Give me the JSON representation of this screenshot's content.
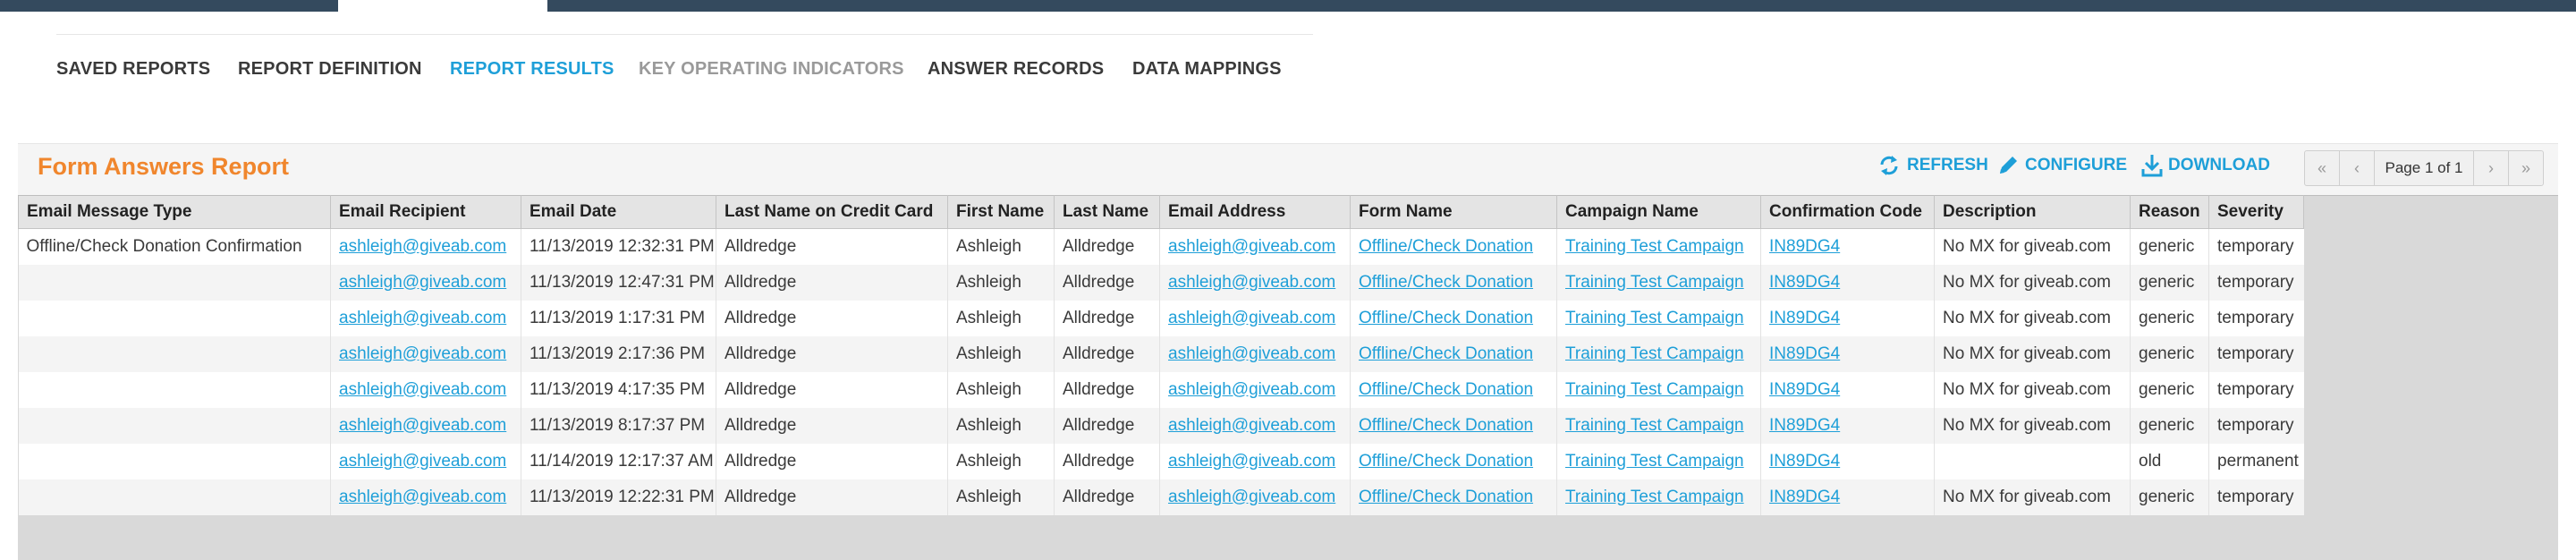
{
  "tabs": [
    {
      "label": "SAVED REPORTS",
      "state": "normal"
    },
    {
      "label": "REPORT DEFINITION",
      "state": "normal"
    },
    {
      "label": "REPORT RESULTS",
      "state": "active"
    },
    {
      "label": "KEY OPERATING INDICATORS",
      "state": "disabled"
    },
    {
      "label": "ANSWER RECORDS",
      "state": "normal"
    },
    {
      "label": "DATA MAPPINGS",
      "state": "normal"
    }
  ],
  "report": {
    "title": "Form Answers Report"
  },
  "actions": {
    "refresh": {
      "label": "REFRESH",
      "icon": "refresh-icon"
    },
    "configure": {
      "label": "CONFIGURE",
      "icon": "pencil-icon"
    },
    "download": {
      "label": "DOWNLOAD",
      "icon": "download-icon"
    }
  },
  "pager": {
    "text": "Page 1 of 1"
  },
  "colors": {
    "accent": "#1e9fd8",
    "title": "#f0862d",
    "topbar": "#344a5e"
  },
  "table": {
    "columns": [
      "Email Message Type",
      "Email Recipient",
      "Email Date",
      "Last Name on Credit Card",
      "First Name",
      "Last Name",
      "Email Address",
      "Form Name",
      "Campaign Name",
      "Confirmation Code",
      "Description",
      "Reason",
      "Severity"
    ],
    "rows": [
      [
        "Offline/Check Donation Confirmation",
        "ashleigh@giveab.com",
        "11/13/2019 12:32:31 PM",
        "Alldredge",
        "Ashleigh",
        "Alldredge",
        "ashleigh@giveab.com",
        "Offline/Check Donation",
        "Training Test Campaign",
        "IN89DG4",
        "No MX for giveab.com",
        "generic",
        "temporary"
      ],
      [
        "",
        "ashleigh@giveab.com",
        "11/13/2019 12:47:31 PM",
        "Alldredge",
        "Ashleigh",
        "Alldredge",
        "ashleigh@giveab.com",
        "Offline/Check Donation",
        "Training Test Campaign",
        "IN89DG4",
        "No MX for giveab.com",
        "generic",
        "temporary"
      ],
      [
        "",
        "ashleigh@giveab.com",
        "11/13/2019 1:17:31 PM",
        "Alldredge",
        "Ashleigh",
        "Alldredge",
        "ashleigh@giveab.com",
        "Offline/Check Donation",
        "Training Test Campaign",
        "IN89DG4",
        "No MX for giveab.com",
        "generic",
        "temporary"
      ],
      [
        "",
        "ashleigh@giveab.com",
        "11/13/2019 2:17:36 PM",
        "Alldredge",
        "Ashleigh",
        "Alldredge",
        "ashleigh@giveab.com",
        "Offline/Check Donation",
        "Training Test Campaign",
        "IN89DG4",
        "No MX for giveab.com",
        "generic",
        "temporary"
      ],
      [
        "",
        "ashleigh@giveab.com",
        "11/13/2019 4:17:35 PM",
        "Alldredge",
        "Ashleigh",
        "Alldredge",
        "ashleigh@giveab.com",
        "Offline/Check Donation",
        "Training Test Campaign",
        "IN89DG4",
        "No MX for giveab.com",
        "generic",
        "temporary"
      ],
      [
        "",
        "ashleigh@giveab.com",
        "11/13/2019 8:17:37 PM",
        "Alldredge",
        "Ashleigh",
        "Alldredge",
        "ashleigh@giveab.com",
        "Offline/Check Donation",
        "Training Test Campaign",
        "IN89DG4",
        "No MX for giveab.com",
        "generic",
        "temporary"
      ],
      [
        "",
        "ashleigh@giveab.com",
        "11/14/2019 12:17:37 AM",
        "Alldredge",
        "Ashleigh",
        "Alldredge",
        "ashleigh@giveab.com",
        "Offline/Check Donation",
        "Training Test Campaign",
        "IN89DG4",
        "",
        "old",
        "permanent"
      ],
      [
        "",
        "ashleigh@giveab.com",
        "11/13/2019 12:22:31 PM",
        "Alldredge",
        "Ashleigh",
        "Alldredge",
        "ashleigh@giveab.com",
        "Offline/Check Donation",
        "Training Test Campaign",
        "IN89DG4",
        "No MX for giveab.com",
        "generic",
        "temporary"
      ]
    ]
  }
}
